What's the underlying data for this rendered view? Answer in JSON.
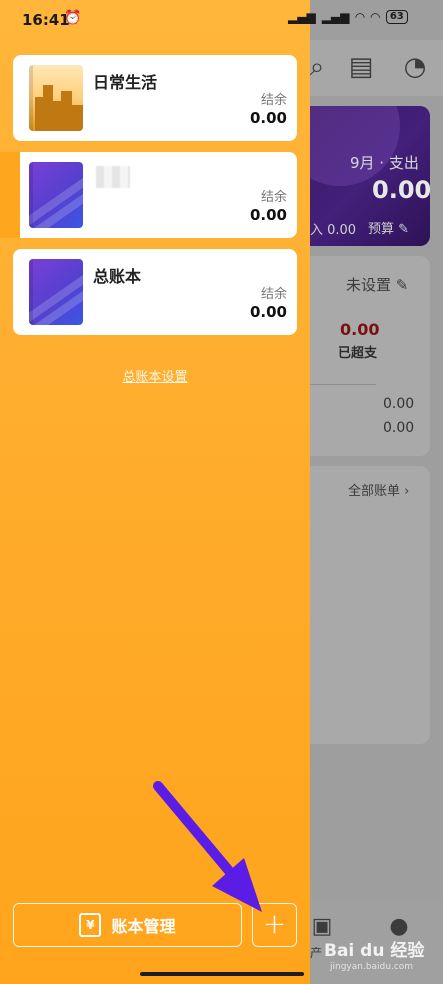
{
  "status_bar": {
    "time": "16:41",
    "alarm_icon": "alarm-icon",
    "net1": "HD",
    "net2": "HD",
    "battery": "63"
  },
  "background": {
    "month_label": "9月 · 支出",
    "month_amount": "0.00",
    "income_label": "入 0.00",
    "budget_label": "预算 ✎",
    "budget_status": "未设置 ✎",
    "over_value": "0.00",
    "over_label": "已超支",
    "value_1": "0.00",
    "value_2": "0.00",
    "all_bills_label": "全部账单 ›",
    "nav_partial_label": "产",
    "watermark": "Bai du 经验",
    "watermark_sub": "jingyan.baidu.com"
  },
  "drawer": {
    "books": [
      {
        "name": "日常生活",
        "balance_label": "结余",
        "balance": "0.00",
        "cover": "city-cover"
      },
      {
        "name": "",
        "balance_label": "结余",
        "balance": "0.00",
        "cover": "purple-cover"
      },
      {
        "name": "总账本",
        "balance_label": "结余",
        "balance": "0.00",
        "cover": "purple-cover"
      }
    ],
    "settings_link": "总账本设置",
    "manage_button": "账本管理",
    "manage_icon_glyph": "¥",
    "add_button": "+"
  },
  "colors": {
    "drawer_top": "#ffb63a",
    "drawer_bottom": "#ffa41c",
    "arrow": "#5b1ce6",
    "negative": "#7a1010"
  }
}
